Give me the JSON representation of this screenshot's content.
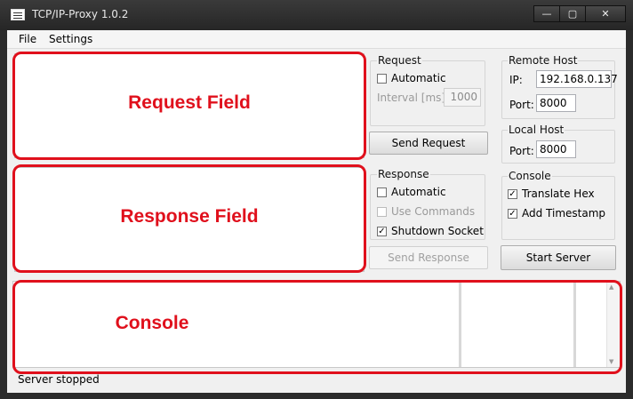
{
  "window": {
    "title": "TCP/IP-Proxy 1.0.2"
  },
  "menu": {
    "file": "File",
    "settings": "Settings"
  },
  "request_panel": {
    "group_title": "Request",
    "automatic_label": "Automatic",
    "automatic_checked": false,
    "interval_label": "Interval [ms]:",
    "interval_value": "1000",
    "send_button": "Send Request"
  },
  "response_panel": {
    "group_title": "Response",
    "automatic_label": "Automatic",
    "automatic_checked": false,
    "use_commands_label": "Use Commands",
    "use_commands_checked": false,
    "shutdown_label": "Shutdown Socket",
    "shutdown_checked": true,
    "send_button": "Send Response"
  },
  "remote_host": {
    "group_title": "Remote Host",
    "ip_label": "IP:",
    "ip_value": "192.168.0.137",
    "port_label": "Port:",
    "port_value": "8000"
  },
  "local_host": {
    "group_title": "Local Host",
    "port_label": "Port:",
    "port_value": "8000"
  },
  "console_settings": {
    "group_title": "Console",
    "translate_hex_label": "Translate Hex",
    "translate_hex_checked": true,
    "add_timestamp_label": "Add Timestamp",
    "add_timestamp_checked": true
  },
  "start_server_button": "Start Server",
  "annotations": {
    "request_field": "Request Field",
    "response_field": "Response Field",
    "console": "Console"
  },
  "status": {
    "text": "Server stopped"
  },
  "colors": {
    "annotation_red": "#e0101c"
  }
}
